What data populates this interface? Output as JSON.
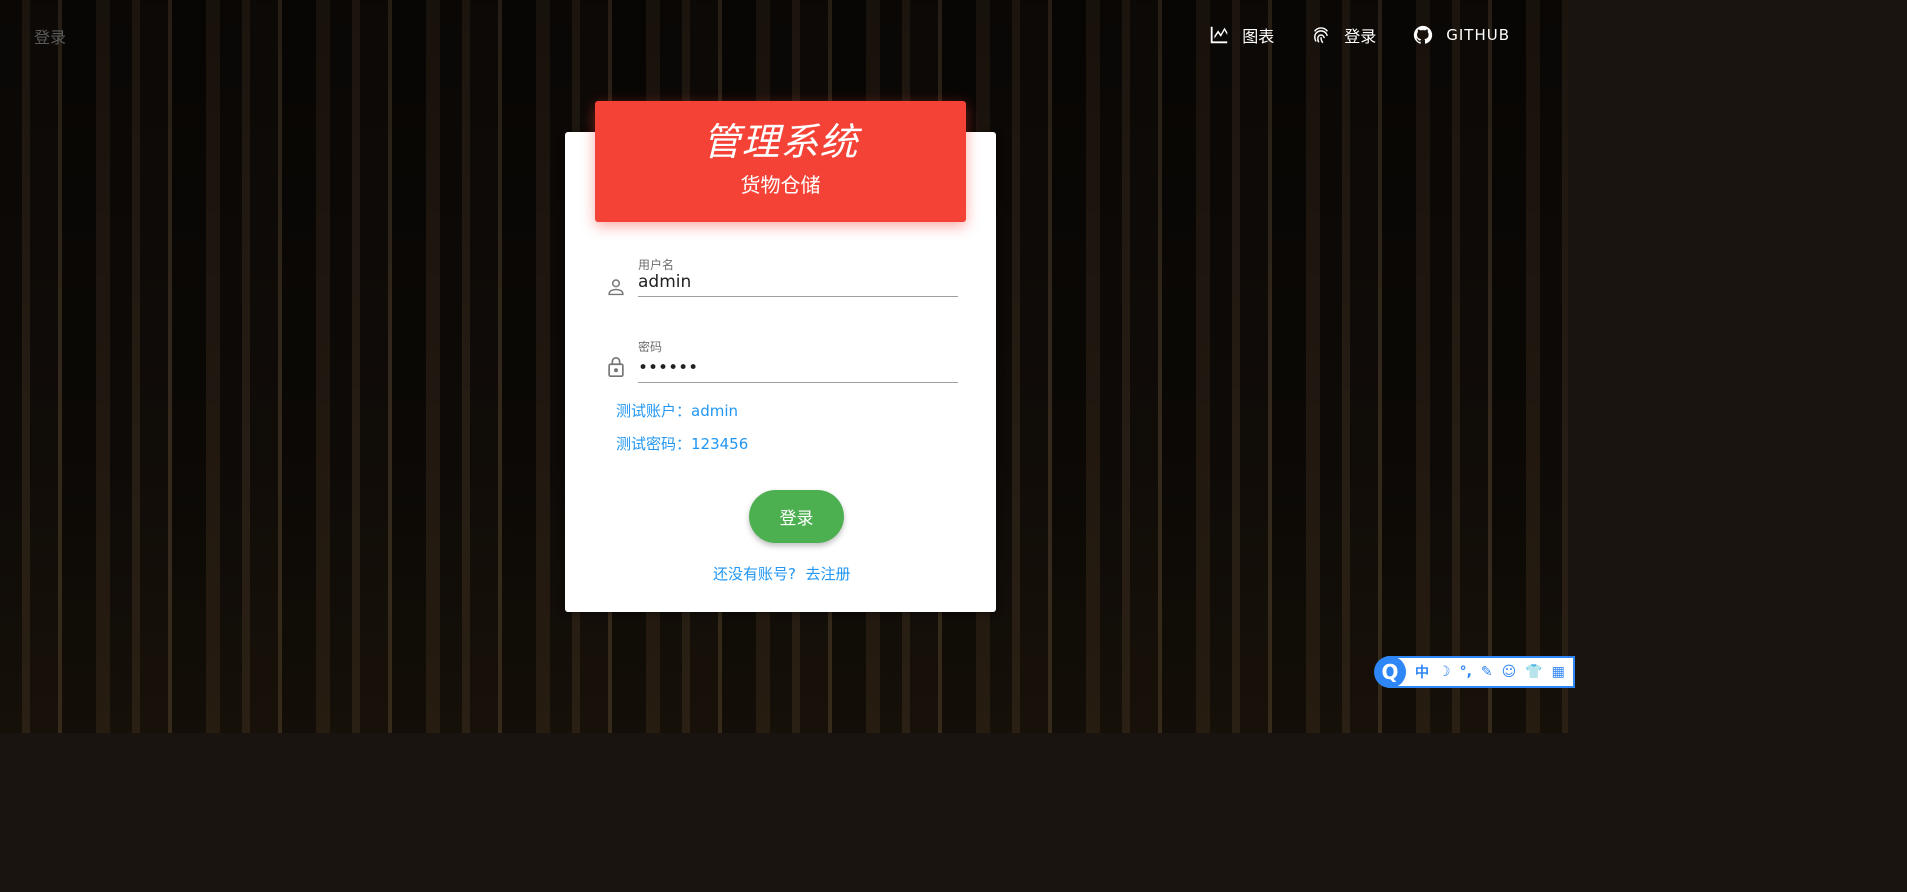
{
  "nav": {
    "brand": "登录",
    "items": [
      {
        "label": "图表",
        "icon": "chart-icon"
      },
      {
        "label": "登录",
        "icon": "fingerprint-icon"
      },
      {
        "label": "GITHUB",
        "icon": "github-icon"
      }
    ]
  },
  "card": {
    "title": "管理系统",
    "subtitle": "货物仓储",
    "username": {
      "label": "用户名",
      "value": "admin"
    },
    "password": {
      "label": "密码",
      "value": "••••••"
    },
    "hint_account": "测试账户：admin",
    "hint_password": "测试密码：123456",
    "login_button": "登录",
    "register_prompt": "还没有账号?",
    "register_link": "去注册"
  },
  "ime": {
    "logo": "Q",
    "tools": [
      "中",
      "☽",
      "°,",
      "✎",
      "☺",
      "👕",
      "▦"
    ]
  },
  "colors": {
    "header": "#f44336",
    "button": "#4caf50",
    "link": "#2196f3"
  }
}
